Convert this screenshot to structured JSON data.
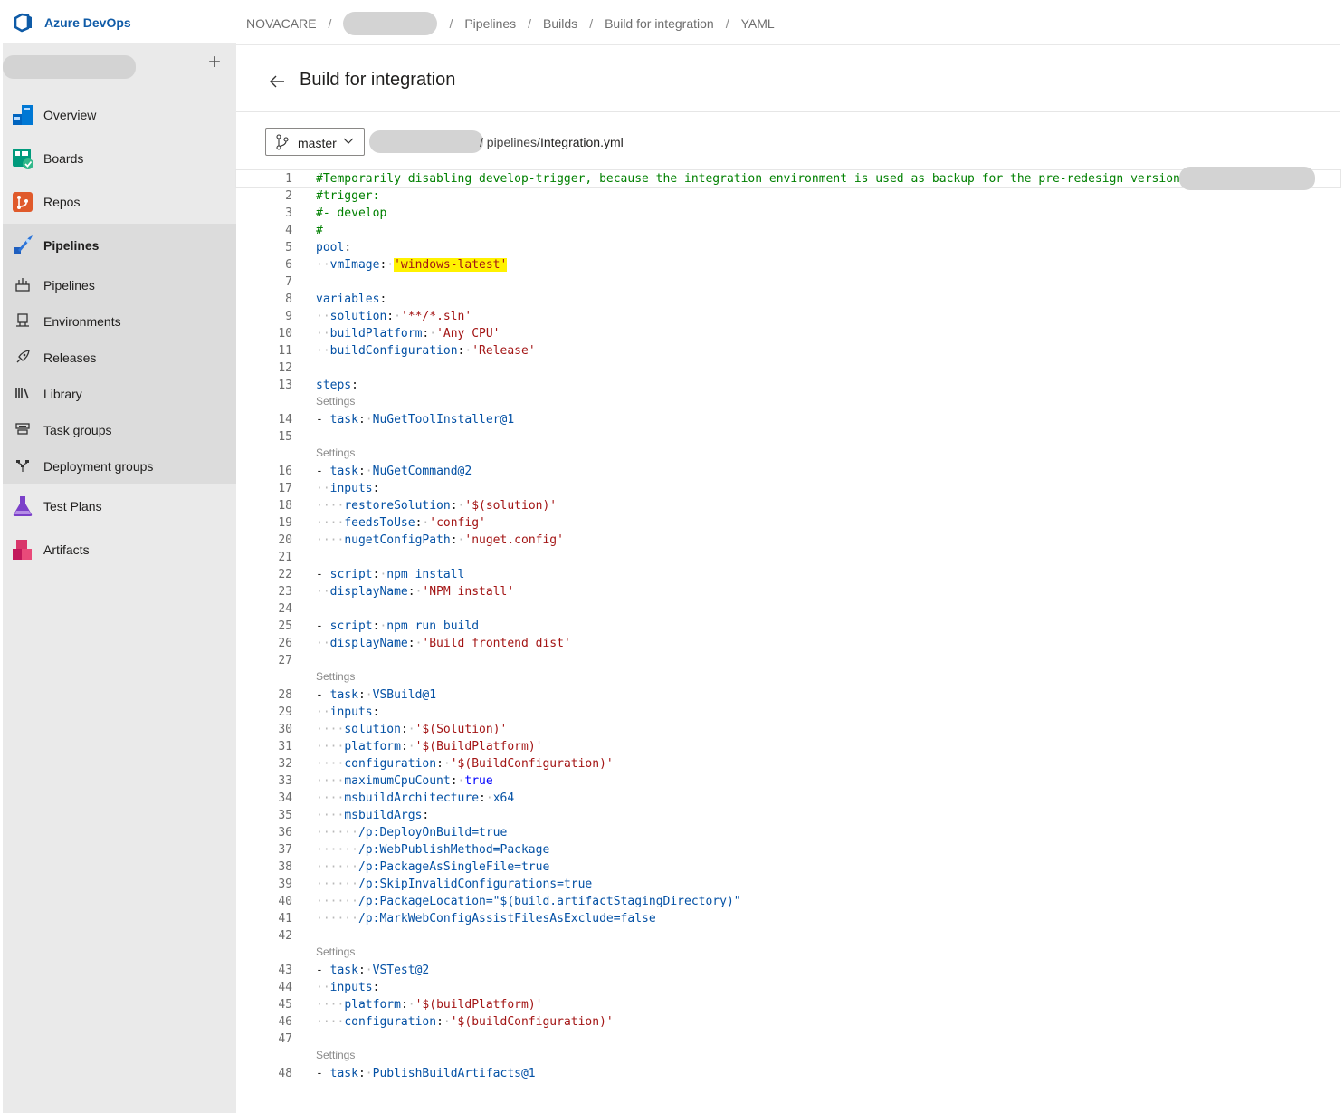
{
  "app": {
    "name": "Azure DevOps"
  },
  "breadcrumb": [
    "NOVACARE",
    "Pipelines",
    "Builds",
    "Build for integration",
    "YAML"
  ],
  "sidebar": {
    "items": [
      {
        "label": "Overview",
        "icon": "overview-icon",
        "color": "#0078d4"
      },
      {
        "label": "Boards",
        "icon": "boards-icon",
        "color": "#009a7c"
      },
      {
        "label": "Repos",
        "icon": "repos-icon",
        "color": "#e05a2b"
      },
      {
        "label": "Pipelines",
        "icon": "pipelines-icon",
        "color": "#2b74d9",
        "active": true
      },
      {
        "label": "Test Plans",
        "icon": "test-plans-icon",
        "color": "#7b40c9"
      },
      {
        "label": "Artifacts",
        "icon": "artifacts-icon",
        "color": "#c2185b"
      }
    ],
    "sub_items": [
      {
        "label": "Pipelines",
        "icon": "pipelines-sub-icon"
      },
      {
        "label": "Environments",
        "icon": "environments-icon"
      },
      {
        "label": "Releases",
        "icon": "releases-icon"
      },
      {
        "label": "Library",
        "icon": "library-icon"
      },
      {
        "label": "Task groups",
        "icon": "task-groups-icon"
      },
      {
        "label": "Deployment groups",
        "icon": "deployment-groups-icon"
      }
    ]
  },
  "header": {
    "title": "Build for integration"
  },
  "branch": {
    "name": "master"
  },
  "file": {
    "dir": "/ pipelines/",
    "name": "Integration.yml"
  },
  "code_lens_label": "Settings",
  "code": [
    {
      "n": "1",
      "t": "#Temporarily disabling develop-trigger, because the integration environment is used as backup for the pre-redesign version o"
    },
    {
      "n": "2",
      "t": "#trigger:"
    },
    {
      "n": "3",
      "t": "#- develop"
    },
    {
      "n": "4",
      "t": "#"
    },
    {
      "n": "5",
      "t": "pool:"
    },
    {
      "n": "6",
      "t": "  vmImage: 'windows-latest'"
    },
    {
      "n": "7",
      "t": ""
    },
    {
      "n": "8",
      "t": "variables:"
    },
    {
      "n": "9",
      "t": "  solution: '**/*.sln'"
    },
    {
      "n": "10",
      "t": "  buildPlatform: 'Any CPU'"
    },
    {
      "n": "11",
      "t": "  buildConfiguration: 'Release'"
    },
    {
      "n": "12",
      "t": ""
    },
    {
      "n": "13",
      "t": "steps:"
    },
    {
      "n": "14",
      "t": "- task: NuGetToolInstaller@1"
    },
    {
      "n": "15",
      "t": ""
    },
    {
      "n": "16",
      "t": "- task: NuGetCommand@2"
    },
    {
      "n": "17",
      "t": "  inputs:"
    },
    {
      "n": "18",
      "t": "    restoreSolution: '$(solution)'"
    },
    {
      "n": "19",
      "t": "    feedsToUse: 'config'"
    },
    {
      "n": "20",
      "t": "    nugetConfigPath: 'nuget.config'"
    },
    {
      "n": "21",
      "t": ""
    },
    {
      "n": "22",
      "t": "- script: npm install"
    },
    {
      "n": "23",
      "t": "  displayName: 'NPM install'"
    },
    {
      "n": "24",
      "t": ""
    },
    {
      "n": "25",
      "t": "- script: npm run build"
    },
    {
      "n": "26",
      "t": "  displayName: 'Build frontend dist'"
    },
    {
      "n": "27",
      "t": ""
    },
    {
      "n": "28",
      "t": "- task: VSBuild@1"
    },
    {
      "n": "29",
      "t": "  inputs:"
    },
    {
      "n": "30",
      "t": "    solution: '$(Solution)'"
    },
    {
      "n": "31",
      "t": "    platform: '$(BuildPlatform)'"
    },
    {
      "n": "32",
      "t": "    configuration: '$(BuildConfiguration)'"
    },
    {
      "n": "33",
      "t": "    maximumCpuCount: true"
    },
    {
      "n": "34",
      "t": "    msbuildArchitecture: x64  "
    },
    {
      "n": "35",
      "t": "    msbuildArgs:"
    },
    {
      "n": "36",
      "t": "      /p:DeployOnBuild=true"
    },
    {
      "n": "37",
      "t": "      /p:WebPublishMethod=Package"
    },
    {
      "n": "38",
      "t": "      /p:PackageAsSingleFile=true"
    },
    {
      "n": "39",
      "t": "      /p:SkipInvalidConfigurations=true"
    },
    {
      "n": "40",
      "t": "      /p:PackageLocation=\"$(build.artifactStagingDirectory)\""
    },
    {
      "n": "41",
      "t": "      /p:MarkWebConfigAssistFilesAsExclude=false"
    },
    {
      "n": "42",
      "t": ""
    },
    {
      "n": "43",
      "t": "- task: VSTest@2"
    },
    {
      "n": "44",
      "t": "  inputs:"
    },
    {
      "n": "45",
      "t": "    platform: '$(buildPlatform)'"
    },
    {
      "n": "46",
      "t": "    configuration: '$(buildConfiguration)'"
    },
    {
      "n": "47",
      "t": ""
    },
    {
      "n": "48",
      "t": "- task: PublishBuildArtifacts@1"
    }
  ]
}
